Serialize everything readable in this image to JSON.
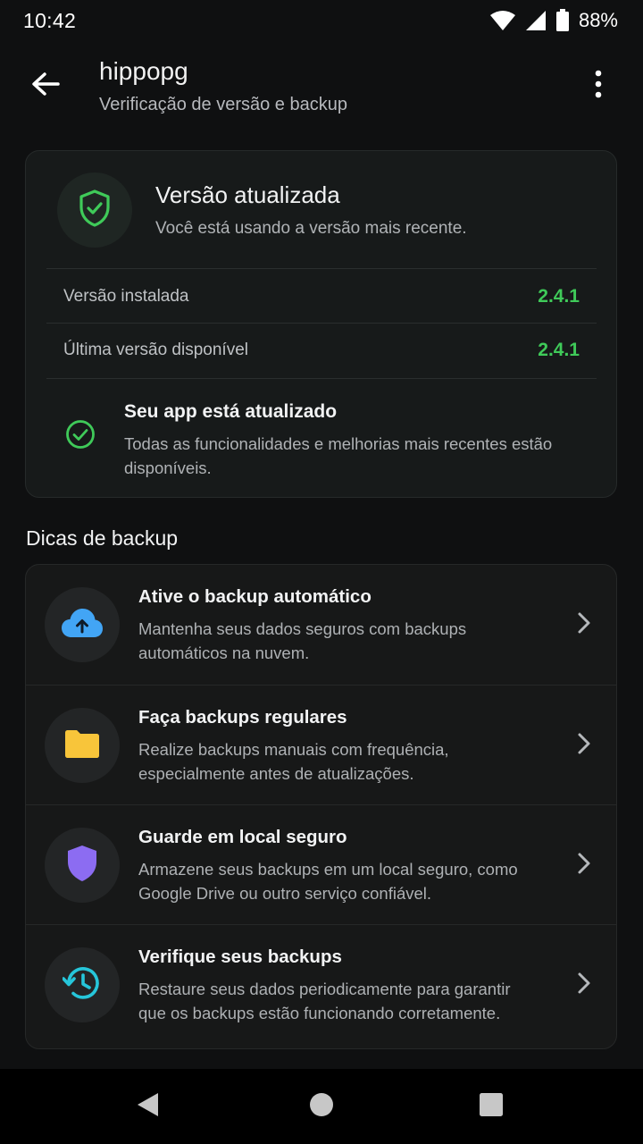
{
  "status_bar": {
    "time": "10:42",
    "battery": "88%"
  },
  "app_bar": {
    "title": "hippopg",
    "subtitle": "Verificação de versão e backup"
  },
  "version_card": {
    "title": "Versão atualizada",
    "description": "Você está usando a versão mais recente.",
    "rows": [
      {
        "label": "Versão instalada",
        "value": "2.4.1"
      },
      {
        "label": "Última versão disponível",
        "value": "2.4.1"
      }
    ],
    "status": {
      "title": "Seu app está atualizado",
      "description": "Todas as funcionalidades e melhorias mais recentes estão disponíveis."
    }
  },
  "backup_tips": {
    "section_title": "Dicas de backup",
    "items": [
      {
        "title": "Ative o backup automático",
        "description": "Mantenha seus dados seguros com backups automáticos na nuvem.",
        "icon": "cloud-upload-icon",
        "color": "#42a5f5"
      },
      {
        "title": "Faça backups regulares",
        "description": "Realize backups manuais com frequência, especialmente antes de atualizações.",
        "icon": "folder-icon",
        "color": "#f8c53a"
      },
      {
        "title": "Guarde em local seguro",
        "description": "Armazene seus backups em um local seguro, como Google Drive ou outro serviço confiável.",
        "icon": "shield-icon",
        "color": "#8c6cf2"
      },
      {
        "title": "Verifique seus backups",
        "description": "Restaure seus dados periodicamente para garantir que os backups estão funcionando corretamente.",
        "icon": "history-icon",
        "color": "#26c6da"
      }
    ]
  },
  "colors": {
    "accent_green": "#3fca59",
    "background": "#0f1011",
    "card": "#171a1a"
  }
}
